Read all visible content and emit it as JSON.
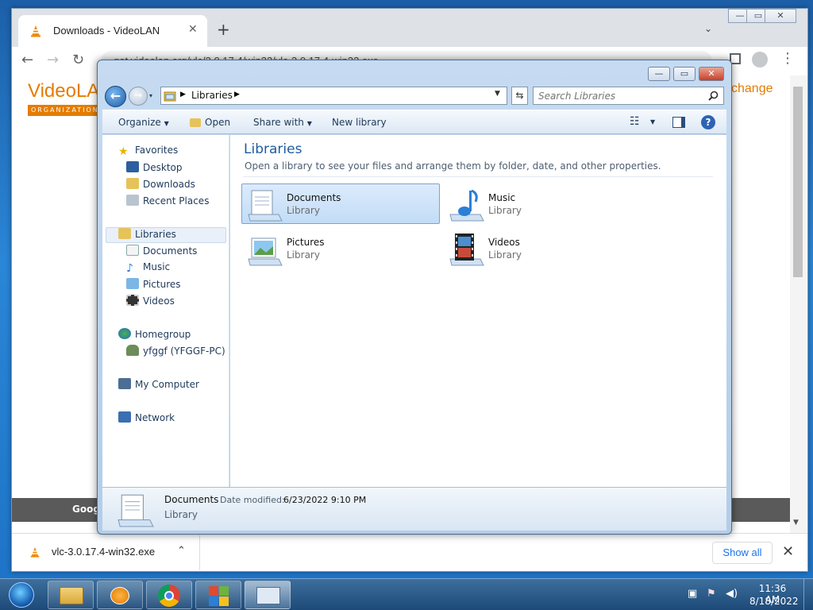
{
  "chrome": {
    "tab_title": "Downloads - VideoLAN",
    "tab_close": "✕",
    "new_tab": "+",
    "tab_search": "⌄",
    "win_min": "—",
    "win_max": "▭",
    "win_close": "✕",
    "back": "←",
    "forward": "→",
    "reload": "↻",
    "url": "get.videolan.org/vlc/3.0.17.4/win32/vlc-3.0.17.4-win32.exe",
    "menu": "⋮"
  },
  "page": {
    "logo": "VideoLAN",
    "logo_sub": "ORGANIZATION",
    "change": "change",
    "footer_text": "Goog"
  },
  "downloads": {
    "item_name": "vlc-3.0.17.4-win32.exe",
    "chevron": "⌃",
    "show_all": "Show all",
    "close": "✕"
  },
  "explorer": {
    "min": "—",
    "max": "▭",
    "close": "✕",
    "back": "←",
    "forward": "→",
    "recent": "▾",
    "address": "Libraries",
    "address_drop": "▼",
    "refresh": "⇆",
    "search_placeholder": "Search Libraries",
    "commands": {
      "organize": "Organize",
      "open": "Open",
      "share_with": "Share with",
      "new_library": "New library"
    },
    "nav": {
      "favorites": "Favorites",
      "desktop": "Desktop",
      "downloads": "Downloads",
      "recent_places": "Recent Places",
      "libraries": "Libraries",
      "documents": "Documents",
      "music": "Music",
      "pictures": "Pictures",
      "videos": "Videos",
      "homegroup": "Homegroup",
      "user": "yfggf (YFGGF-PC)",
      "my_computer": "My Computer",
      "network": "Network"
    },
    "main": {
      "title": "Libraries",
      "subtitle": "Open a library to see your files and arrange them by folder, date, and other properties.",
      "items": [
        {
          "name": "Documents",
          "type": "Library"
        },
        {
          "name": "Music",
          "type": "Library"
        },
        {
          "name": "Pictures",
          "type": "Library"
        },
        {
          "name": "Videos",
          "type": "Library"
        }
      ]
    },
    "details": {
      "name": "Documents",
      "modified_label": "Date modified:",
      "modified_value": "6/23/2022 9:10 PM",
      "type": "Library"
    }
  },
  "taskbar": {
    "time": "11:36 AM",
    "date": "8/18/2022"
  },
  "colors": {
    "accent_orange": "#e57c00",
    "explorer_title": "#1e5b9e",
    "selection": "#c2dcf7"
  }
}
